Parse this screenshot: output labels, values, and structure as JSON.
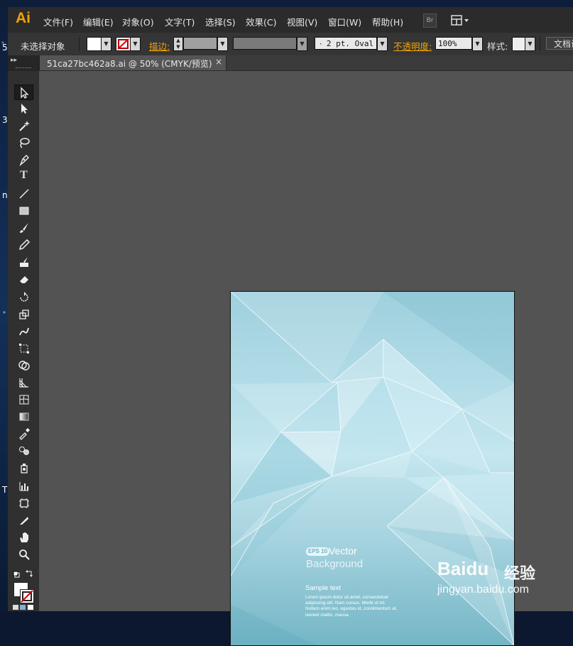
{
  "desktop": {
    "edge_chars": [
      "5",
      "3",
      "n",
      "T"
    ]
  },
  "app": {
    "logo": "Ai"
  },
  "menu": {
    "items": [
      "文件(F)",
      "编辑(E)",
      "对象(O)",
      "文字(T)",
      "选择(S)",
      "效果(C)",
      "视图(V)",
      "窗口(W)",
      "帮助(H)"
    ],
    "bridge_label": "Br"
  },
  "control_bar": {
    "selection_status": "未选择对象",
    "stroke_label": "描边:",
    "brush_value": "2 pt. Oval",
    "opacity_label": "不透明度:",
    "opacity_value": "100%",
    "style_label": "样式:",
    "document_button": "文档设"
  },
  "document": {
    "tab_title": "51ca27bc462a8.ai @ 50% (CMYK/预览)",
    "close": "×"
  },
  "artwork": {
    "badge": "EPS 10",
    "title": "Vector",
    "subtitle": "Background",
    "sample_heading": "Sample text",
    "lorem_lines": [
      "Lorem ipsum dolor sit amet, consectetuer",
      "adipiscing elit. Nam cursus. Morbi ut mi.",
      "Nullam enim leo, egestas id, condimentum at,",
      "laoreet mattis, massa."
    ]
  },
  "watermark": {
    "logo": "Baidu",
    "cn": "经验",
    "url": "jingyan.baidu.com"
  },
  "colors": {
    "accent_orange": "#f0a30a",
    "panel": "#303030",
    "canvas": "#535353"
  }
}
